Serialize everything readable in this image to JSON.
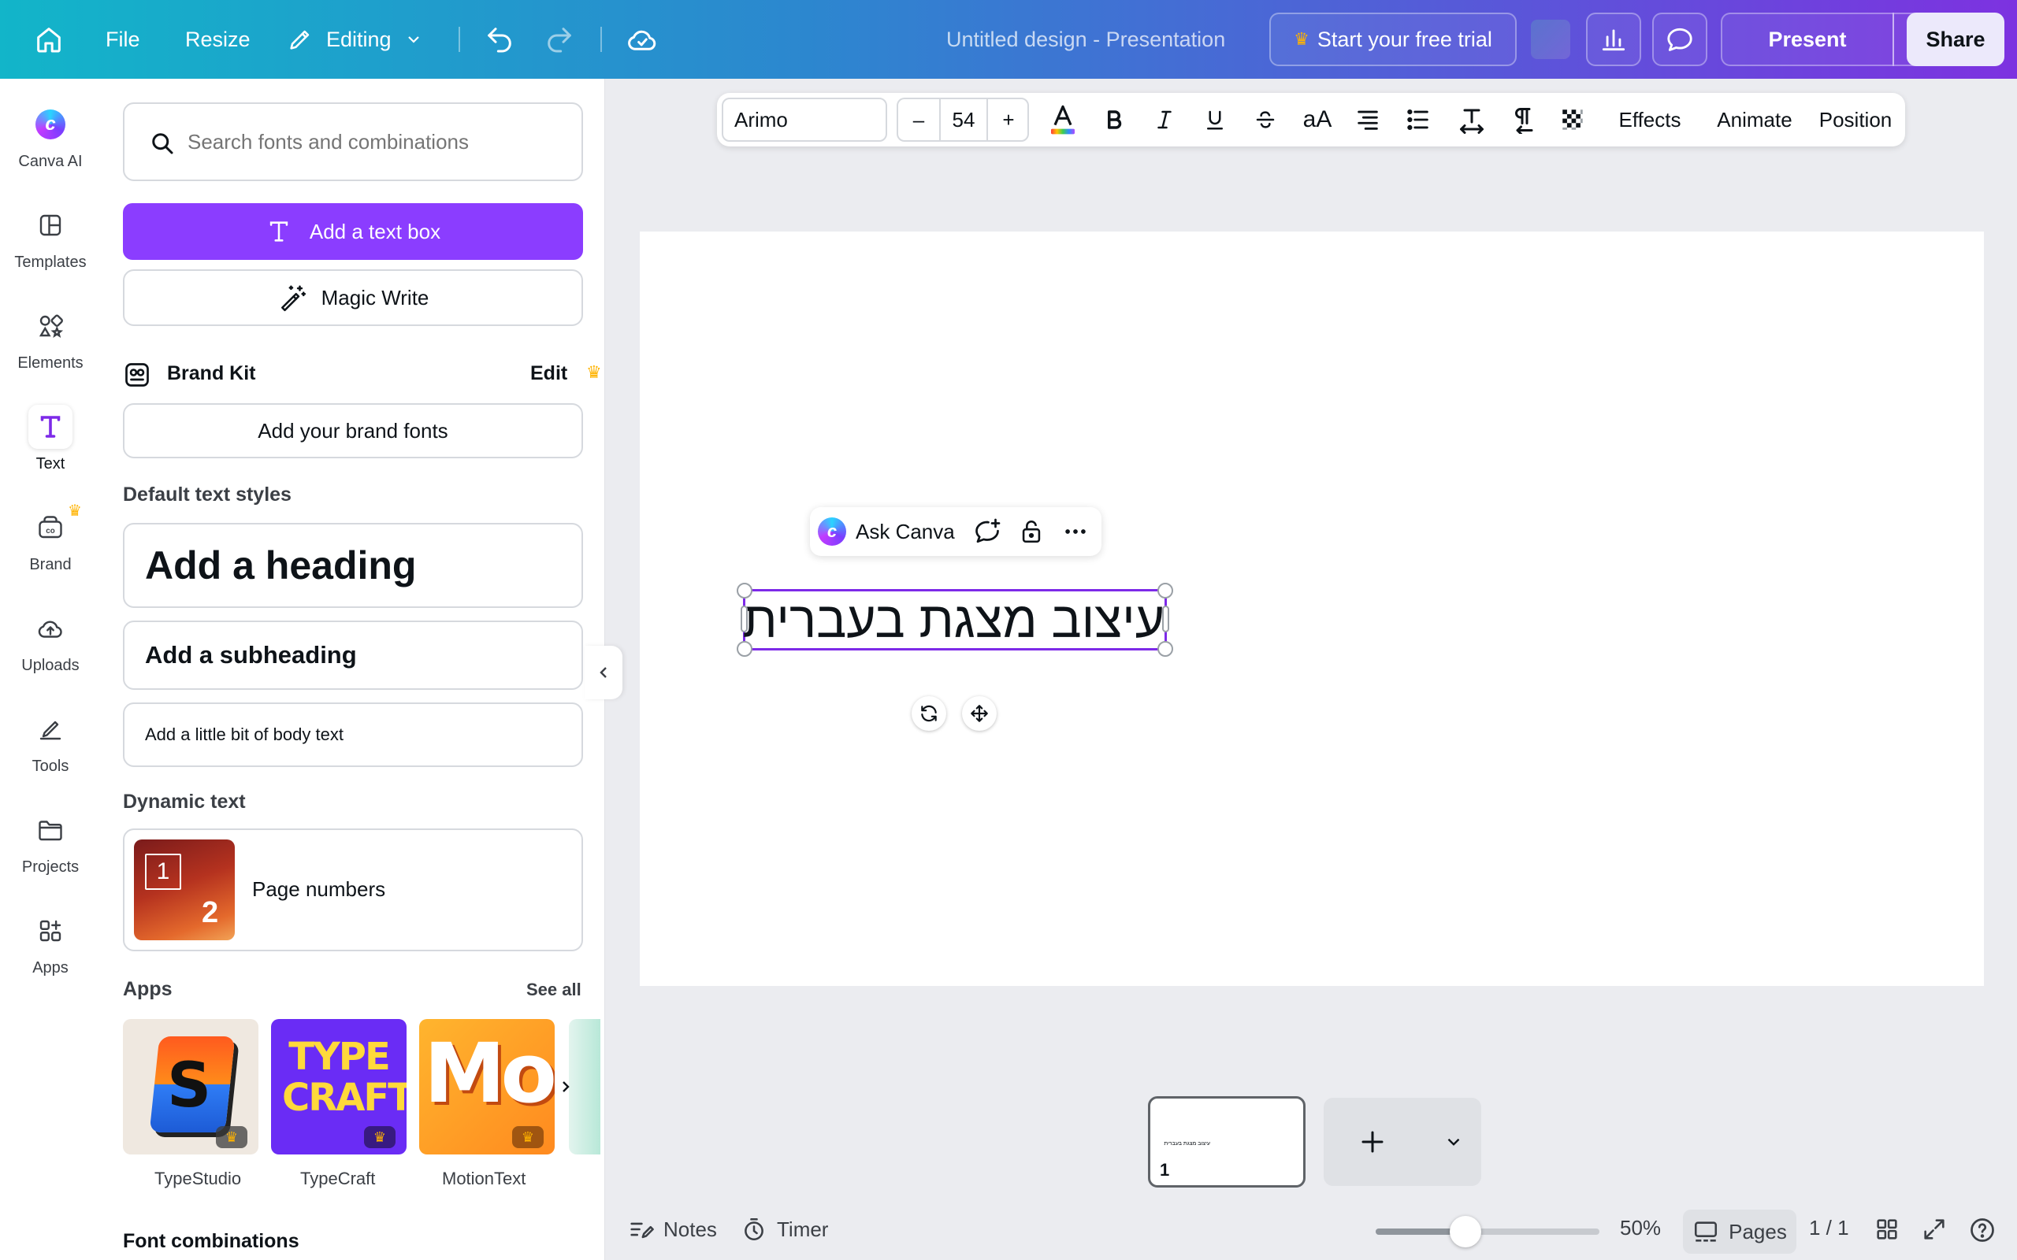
{
  "topbar": {
    "file": "File",
    "resize": "Resize",
    "editing": "Editing",
    "title": "Untitled design - Presentation",
    "trial": "Start your free trial",
    "present": "Present",
    "share": "Share"
  },
  "rail": {
    "items": [
      {
        "label": "Canva AI",
        "icon": "canva-ai-icon"
      },
      {
        "label": "Templates",
        "icon": "templates-icon"
      },
      {
        "label": "Elements",
        "icon": "elements-icon"
      },
      {
        "label": "Text",
        "icon": "text-icon"
      },
      {
        "label": "Brand",
        "icon": "brand-icon"
      },
      {
        "label": "Uploads",
        "icon": "uploads-icon"
      },
      {
        "label": "Tools",
        "icon": "tools-icon"
      },
      {
        "label": "Projects",
        "icon": "projects-icon"
      },
      {
        "label": "Apps",
        "icon": "apps-icon"
      }
    ]
  },
  "panel": {
    "search_placeholder": "Search fonts and combinations",
    "add_text_box": "Add a text box",
    "magic_write": "Magic Write",
    "brand_kit": "Brand Kit",
    "edit": "Edit",
    "add_brand_fonts": "Add your brand fonts",
    "default_styles": "Default text styles",
    "heading": "Add a heading",
    "subheading": "Add a subheading",
    "body": "Add a little bit of body text",
    "dynamic_text": "Dynamic text",
    "page_numbers": "Page numbers",
    "page_num_1": "1",
    "page_num_2": "2",
    "apps": "Apps",
    "see_all": "See all",
    "app_tiles": [
      {
        "label": "TypeStudio",
        "logo": "S"
      },
      {
        "label": "TypeCraft",
        "logo": "TYPE CRAFT"
      },
      {
        "label": "MotionText",
        "logo": "Mo"
      }
    ],
    "font_combinations": "Font combinations"
  },
  "toolbar": {
    "font": "Arimo",
    "size": "54",
    "minus": "–",
    "plus": "+",
    "case": "aA",
    "effects": "Effects",
    "animate": "Animate",
    "position": "Position"
  },
  "canvas": {
    "ask_canva": "Ask Canva",
    "hebrew_text": "עיצוב מצגת בעברית",
    "selection_color": "#7d2ae8"
  },
  "bottom": {
    "page_number": "1",
    "notes": "Notes",
    "timer": "Timer",
    "zoom": "50%",
    "zoom_fraction": 0.4,
    "pages": "Pages",
    "page_count": "1 / 1"
  }
}
